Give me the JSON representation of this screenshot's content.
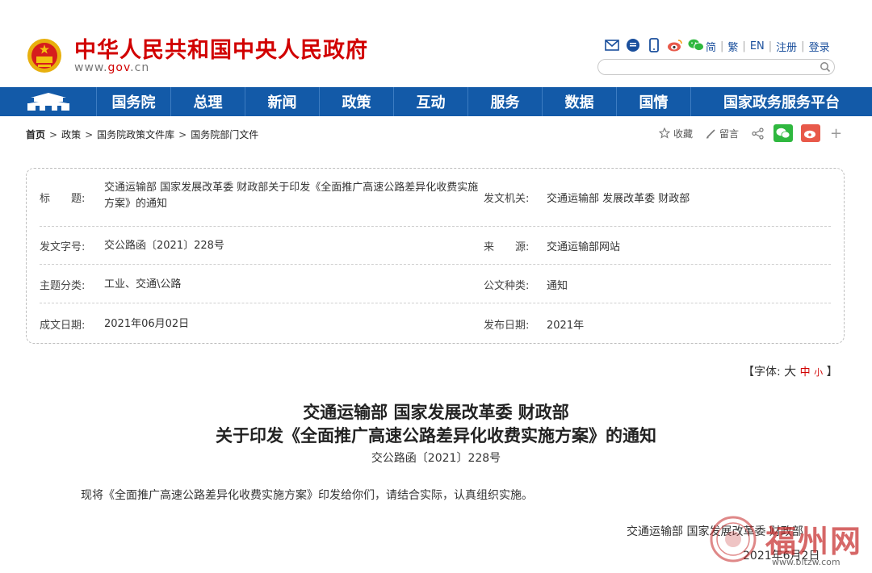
{
  "header": {
    "site_title": "中华人民共和国中央人民政府",
    "site_url_prefix": "www.",
    "site_url_gov": "gov",
    "site_url_suffix": ".cn",
    "tool_icons": [
      "mail-icon",
      "chat-icon",
      "mobile-icon",
      "weibo-icon",
      "wechat-icon"
    ],
    "links": [
      "简",
      "繁",
      "EN",
      "注册",
      "登录"
    ]
  },
  "nav": {
    "items": [
      "国务院",
      "总理",
      "新闻",
      "政策",
      "互动",
      "服务",
      "数据",
      "国情",
      "国家政务服务平台"
    ]
  },
  "breadcrumb": {
    "items": [
      "首页",
      "政策",
      "国务院政策文件库",
      "国务院部门文件"
    ]
  },
  "share": {
    "favorite": "收藏",
    "comment": "留言"
  },
  "info": {
    "title_label": "标　　题:",
    "title_value": "交通运输部 国家发展改革委 财政部关于印发《全面推广高速公路差异化收费实施方案》的通知",
    "issuer_label": "发文机关:",
    "issuer_value": "交通运输部 发展改革委 财政部",
    "docno_label": "发文字号:",
    "docno_value": "交公路函〔2021〕228号",
    "source_label": "来　　源:",
    "source_value": "交通运输部网站",
    "topic_label": "主题分类:",
    "topic_value": "工业、交通\\公路",
    "type_label": "公文种类:",
    "type_value": "通知",
    "written_label": "成文日期:",
    "written_value": "2021年06月02日",
    "published_label": "发布日期:",
    "published_value": "2021年"
  },
  "fontsize": {
    "prefix": "【字体:",
    "big": "大",
    "mid": "中",
    "small": "小",
    "suffix": "】"
  },
  "doc": {
    "title_line1": "交通运输部 国家发展改革委 财政部",
    "title_line2": "关于印发《全面推广高速公路差异化收费实施方案》的通知",
    "number": "交公路函〔2021〕228号",
    "paragraph": "现将《全面推广高速公路差异化收费实施方案》印发给你们，请结合实际，认真组织实施。",
    "signature": "交通运输部 国家发展改革委 财政部",
    "date": "2021年6月2日"
  },
  "watermark": {
    "text": "福州网",
    "url": "www.bltzw.com"
  },
  "colors": {
    "brand_red": "#d10000",
    "nav_blue": "#135aa8",
    "link_blue": "#1a4f9c",
    "wechat_green": "#2fb83f",
    "weibo_red": "#e8594a"
  }
}
